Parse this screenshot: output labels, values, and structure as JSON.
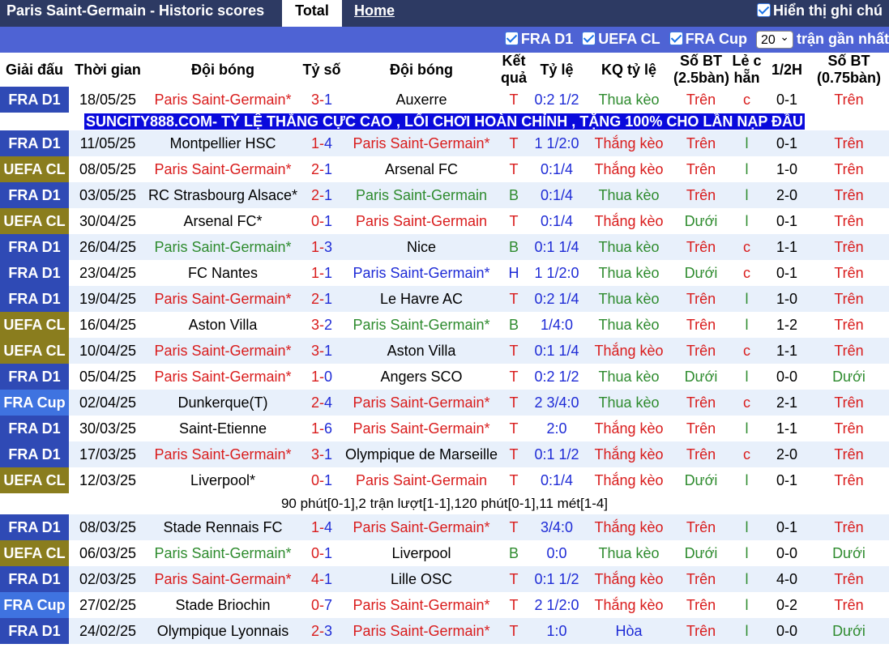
{
  "header": {
    "title": "Paris Saint-Germain - Historic scores",
    "tab_total": "Total",
    "tab_home": "Home",
    "show_notes": "Hiển thị ghi chú"
  },
  "filters": {
    "fra_d1": "FRA D1",
    "uefa_cl": "UEFA CL",
    "fra_cup": "FRA Cup",
    "count": "20",
    "recent_label": "trận gần nhất"
  },
  "columns": [
    "Giải đấu",
    "Thời gian",
    "Đội bóng",
    "Tỷ số",
    "Đội bóng",
    "Kết quả",
    "Tỷ lệ",
    "KQ tỷ lệ",
    "Số BT (2.5bàn)",
    "Lẻ c hẵn",
    "1/2H",
    "Số BT (0.75bàn)"
  ],
  "ad_text": "SUNCITY888.COM- TỶ LỆ THẮNG CỰC CAO , LỐI CHƠI HOÀN CHỈNH , TẶNG 100% CHO LẦN NẠP ĐẦU",
  "note_text": "90 phút[0-1],2 trận lượt[1-1],120 phút[0-1],11 mét[1-4]",
  "colors": {
    "red": "#d91c1c",
    "blue": "#1e2bd6",
    "green": "#2e8b2e",
    "header_bg": "#2d3a63",
    "filter_bg": "#4e63d4"
  },
  "matches": [
    {
      "league": "FRA D1",
      "date": "18/05/25",
      "home": "Paris Saint-Germain*",
      "score_home": "3",
      "score_away": "1",
      "away": "Auxerre",
      "result": "T",
      "odds": "0:2 1/2",
      "odds_result": "Thua kèo",
      "ou": "Trên",
      "oe": "c",
      "half": "0-1",
      "ou2": "Trên"
    },
    {
      "league": "FRA D1",
      "date": "11/05/25",
      "home": "Montpellier HSC",
      "score_home": "1",
      "score_away": "4",
      "away": "Paris Saint-Germain*",
      "result": "T",
      "odds": "1 1/2:0",
      "odds_result": "Thắng kèo",
      "ou": "Trên",
      "oe": "l",
      "half": "0-1",
      "ou2": "Trên"
    },
    {
      "league": "UEFA CL",
      "date": "08/05/25",
      "home": "Paris Saint-Germain*",
      "score_home": "2",
      "score_away": "1",
      "away": "Arsenal FC",
      "result": "T",
      "odds": "0:1/4",
      "odds_result": "Thắng kèo",
      "ou": "Trên",
      "oe": "l",
      "half": "1-0",
      "ou2": "Trên"
    },
    {
      "league": "FRA D1",
      "date": "03/05/25",
      "home": "RC Strasbourg Alsace*",
      "score_home": "2",
      "score_away": "1",
      "away": "Paris Saint-Germain",
      "result": "B",
      "odds": "0:1/4",
      "odds_result": "Thua kèo",
      "ou": "Trên",
      "oe": "l",
      "half": "2-0",
      "ou2": "Trên"
    },
    {
      "league": "UEFA CL",
      "date": "30/04/25",
      "home": "Arsenal FC*",
      "score_home": "0",
      "score_away": "1",
      "away": "Paris Saint-Germain",
      "result": "T",
      "odds": "0:1/4",
      "odds_result": "Thắng kèo",
      "ou": "Dưới",
      "oe": "l",
      "half": "0-1",
      "ou2": "Trên"
    },
    {
      "league": "FRA D1",
      "date": "26/04/25",
      "home": "Paris Saint-Germain*",
      "score_home": "1",
      "score_away": "3",
      "away": "Nice",
      "result": "B",
      "odds": "0:1 1/4",
      "odds_result": "Thua kèo",
      "ou": "Trên",
      "oe": "c",
      "half": "1-1",
      "ou2": "Trên"
    },
    {
      "league": "FRA D1",
      "date": "23/04/25",
      "home": "FC Nantes",
      "score_home": "1",
      "score_away": "1",
      "away": "Paris Saint-Germain*",
      "result": "H",
      "odds": "1 1/2:0",
      "odds_result": "Thua kèo",
      "ou": "Dưới",
      "oe": "c",
      "half": "0-1",
      "ou2": "Trên"
    },
    {
      "league": "FRA D1",
      "date": "19/04/25",
      "home": "Paris Saint-Germain*",
      "score_home": "2",
      "score_away": "1",
      "away": "Le Havre AC",
      "result": "T",
      "odds": "0:2 1/4",
      "odds_result": "Thua kèo",
      "ou": "Trên",
      "oe": "l",
      "half": "1-0",
      "ou2": "Trên"
    },
    {
      "league": "UEFA CL",
      "date": "16/04/25",
      "home": "Aston Villa",
      "score_home": "3",
      "score_away": "2",
      "away": "Paris Saint-Germain*",
      "result": "B",
      "odds": "1/4:0",
      "odds_result": "Thua kèo",
      "ou": "Trên",
      "oe": "l",
      "half": "1-2",
      "ou2": "Trên"
    },
    {
      "league": "UEFA CL",
      "date": "10/04/25",
      "home": "Paris Saint-Germain*",
      "score_home": "3",
      "score_away": "1",
      "away": "Aston Villa",
      "result": "T",
      "odds": "0:1 1/4",
      "odds_result": "Thắng kèo",
      "ou": "Trên",
      "oe": "c",
      "half": "1-1",
      "ou2": "Trên"
    },
    {
      "league": "FRA D1",
      "date": "05/04/25",
      "home": "Paris Saint-Germain*",
      "score_home": "1",
      "score_away": "0",
      "away": "Angers SCO",
      "result": "T",
      "odds": "0:2 1/2",
      "odds_result": "Thua kèo",
      "ou": "Dưới",
      "oe": "l",
      "half": "0-0",
      "ou2": "Dưới"
    },
    {
      "league": "FRA Cup",
      "date": "02/04/25",
      "home": "Dunkerque(T)",
      "score_home": "2",
      "score_away": "4",
      "away": "Paris Saint-Germain*",
      "result": "T",
      "odds": "2 3/4:0",
      "odds_result": "Thua kèo",
      "ou": "Trên",
      "oe": "c",
      "half": "2-1",
      "ou2": "Trên"
    },
    {
      "league": "FRA D1",
      "date": "30/03/25",
      "home": "Saint-Etienne",
      "score_home": "1",
      "score_away": "6",
      "away": "Paris Saint-Germain*",
      "result": "T",
      "odds": "2:0",
      "odds_result": "Thắng kèo",
      "ou": "Trên",
      "oe": "l",
      "half": "1-1",
      "ou2": "Trên"
    },
    {
      "league": "FRA D1",
      "date": "17/03/25",
      "home": "Paris Saint-Germain*",
      "score_home": "3",
      "score_away": "1",
      "away": "Olympique de Marseille",
      "result": "T",
      "odds": "0:1 1/2",
      "odds_result": "Thắng kèo",
      "ou": "Trên",
      "oe": "c",
      "half": "2-0",
      "ou2": "Trên"
    },
    {
      "league": "UEFA CL",
      "date": "12/03/25",
      "home": "Liverpool*",
      "score_home": "0",
      "score_away": "1",
      "away": "Paris Saint-Germain",
      "result": "T",
      "odds": "0:1/4",
      "odds_result": "Thắng kèo",
      "ou": "Dưới",
      "oe": "l",
      "half": "0-1",
      "ou2": "Trên"
    },
    {
      "league": "FRA D1",
      "date": "08/03/25",
      "home": "Stade Rennais FC",
      "score_home": "1",
      "score_away": "4",
      "away": "Paris Saint-Germain*",
      "result": "T",
      "odds": "3/4:0",
      "odds_result": "Thắng kèo",
      "ou": "Trên",
      "oe": "l",
      "half": "0-1",
      "ou2": "Trên"
    },
    {
      "league": "UEFA CL",
      "date": "06/03/25",
      "home": "Paris Saint-Germain*",
      "score_home": "0",
      "score_away": "1",
      "away": "Liverpool",
      "result": "B",
      "odds": "0:0",
      "odds_result": "Thua kèo",
      "ou": "Dưới",
      "oe": "l",
      "half": "0-0",
      "ou2": "Dưới"
    },
    {
      "league": "FRA D1",
      "date": "02/03/25",
      "home": "Paris Saint-Germain*",
      "score_home": "4",
      "score_away": "1",
      "away": "Lille OSC",
      "result": "T",
      "odds": "0:1 1/2",
      "odds_result": "Thắng kèo",
      "ou": "Trên",
      "oe": "l",
      "half": "4-0",
      "ou2": "Trên"
    },
    {
      "league": "FRA Cup",
      "date": "27/02/25",
      "home": "Stade Briochin",
      "score_home": "0",
      "score_away": "7",
      "away": "Paris Saint-Germain*",
      "result": "T",
      "odds": "2 1/2:0",
      "odds_result": "Thắng kèo",
      "ou": "Trên",
      "oe": "l",
      "half": "0-2",
      "ou2": "Trên"
    },
    {
      "league": "FRA D1",
      "date": "24/02/25",
      "home": "Olympique Lyonnais",
      "score_home": "2",
      "score_away": "3",
      "away": "Paris Saint-Germain*",
      "result": "T",
      "odds": "1:0",
      "odds_result": "Hòa",
      "ou": "Trên",
      "oe": "l",
      "half": "0-0",
      "ou2": "Dưới"
    }
  ]
}
